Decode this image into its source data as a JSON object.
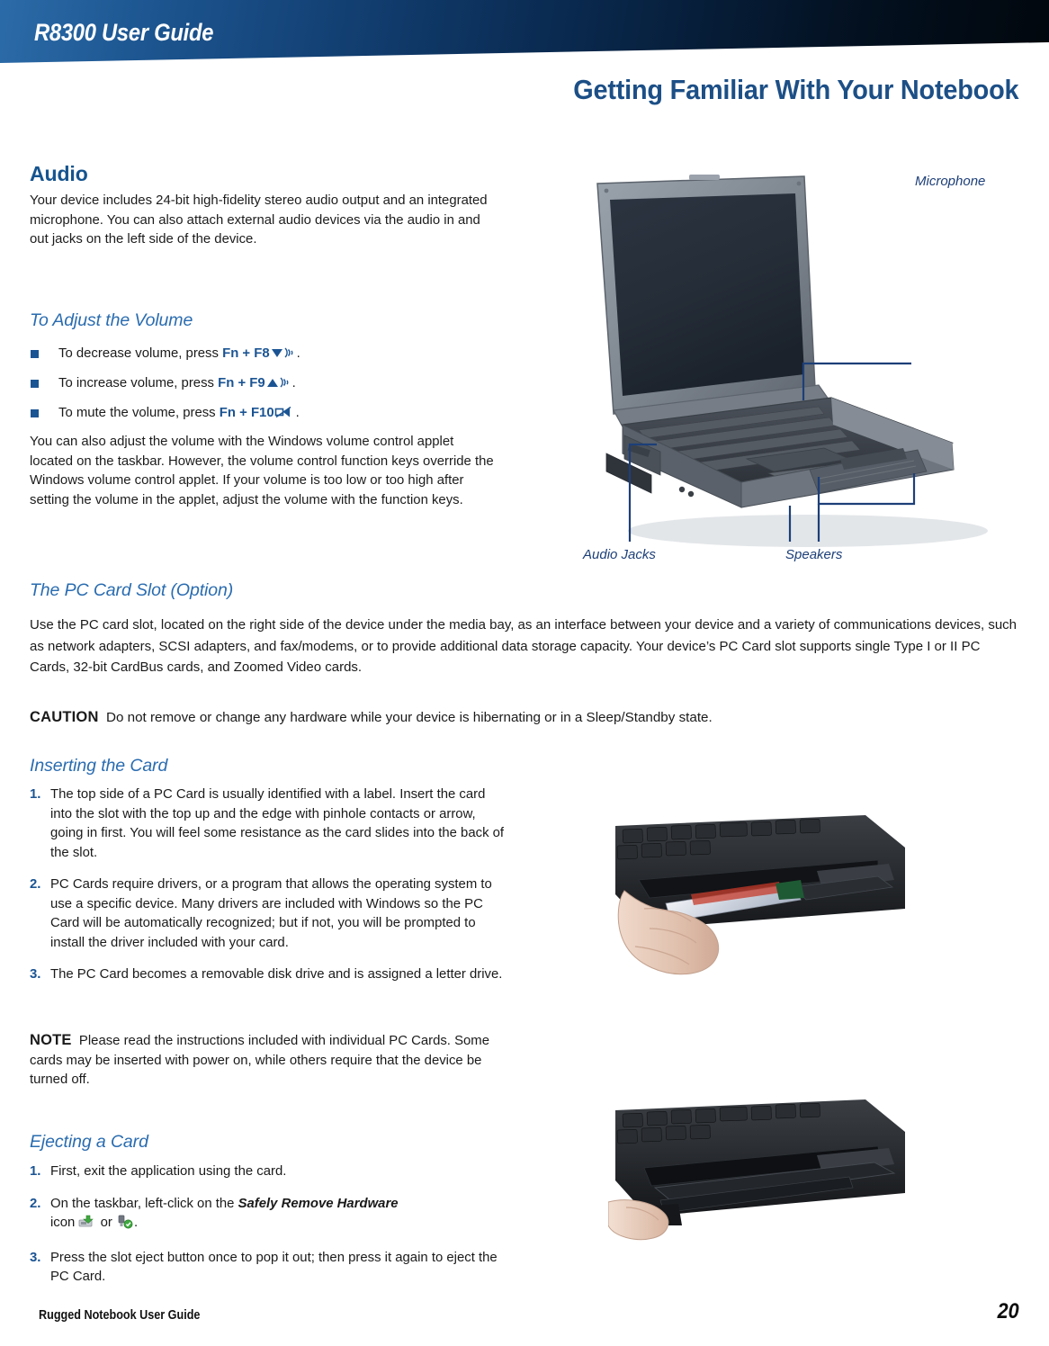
{
  "header": {
    "guide_title": "R8300 User Guide",
    "chapter_title": "Getting Familiar With Your Notebook",
    "banner_color_left": "#2b6ba8",
    "banner_color_right": "#01070d",
    "title_color": "#1c4f86"
  },
  "audio": {
    "heading": "Audio",
    "intro": "Your device includes 24-bit high-fidelity stereo audio output and an integrated microphone. You can also attach external audio devices via the audio in and out jacks on the left side of the device.",
    "volume_heading": "To Adjust the Volume",
    "bullets": [
      {
        "prefix": "To decrease volume, press ",
        "keys": "Fn + F8",
        "icon": "volume-down-icon",
        "suffix": "."
      },
      {
        "prefix": "To increase volume, press ",
        "keys": "Fn + F9",
        "icon": "volume-up-icon",
        "suffix": "."
      },
      {
        "prefix": "To mute the volume, press ",
        "keys": "Fn + F10",
        "icon": "volume-mute-icon",
        "suffix": "."
      }
    ],
    "volume_note": "You can also adjust the volume with the Windows volume control applet located on the taskbar. However, the volume control function keys override the Windows volume control applet. If your volume is too low or too high after setting the volume in the applet, adjust the volume with the function keys."
  },
  "figure_notebook": {
    "name": "rugged-notebook-photo",
    "labels": {
      "microphone": "Microphone",
      "audio_jacks": "Audio Jacks",
      "speakers": "Speakers"
    },
    "callout_color": "#1d3f78"
  },
  "pccard": {
    "heading": "The PC Card Slot (Option)",
    "body": "Use the PC card slot, located on the right side of the device under the media bay, as an interface between your device and a variety of communications devices, such as network adapters, SCSI adapters, and fax/modems, or to provide additional data storage capacity. Your device’s PC Card slot supports single Type I or II PC Cards, 32-bit CardBus cards, and Zoomed Video cards.",
    "caution_label": "CAUTION",
    "caution_text": "Do not remove or change any hardware while your device is hibernating or in a Sleep/Standby state."
  },
  "inserting": {
    "heading": "Inserting the Card",
    "steps": [
      {
        "num": "1.",
        "text": "The top side of a PC Card is usually identified with a label. Insert the card into the slot with the top up and the edge with pinhole contacts or arrow, going in first. You will feel some resistance as the card slides into the back of the slot."
      },
      {
        "num": "2.",
        "text": "PC Cards require drivers, or a program that allows the operating system to use a specific device. Many drivers are included with Windows so the PC Card will be automatically recognized; but if not, you will be prompted to install the driver included with your card."
      },
      {
        "num": "3.",
        "text": "The PC Card becomes a removable disk drive and is assigned a letter drive."
      }
    ],
    "note_label": "NOTE",
    "note_text": "Please read the instructions included with individual PC Cards. Some cards may be inserted with power on, while others require that the device be turned off."
  },
  "ejecting": {
    "heading": "Ejecting a Card",
    "steps": [
      {
        "num": "1.",
        "text": "First, exit the application using the card."
      },
      {
        "num": "3.",
        "text": "Press the slot eject button once to pop it out; then press it again to eject the PC Card."
      }
    ],
    "step2": {
      "num": "2.",
      "prefix": "On the taskbar, left-click on the ",
      "emphasis": "Safely Remove Hardware",
      "middle": "icon ",
      "separator": " or ",
      "suffix": ".",
      "icon_a": "safely-remove-hardware-icon",
      "icon_b": "usb-eject-icon"
    }
  },
  "figure_insert": {
    "name": "pc-card-insertion-photo"
  },
  "figure_eject": {
    "name": "pc-card-eject-photo"
  },
  "footer": {
    "left": "Rugged Notebook User Guide",
    "page": "20"
  }
}
